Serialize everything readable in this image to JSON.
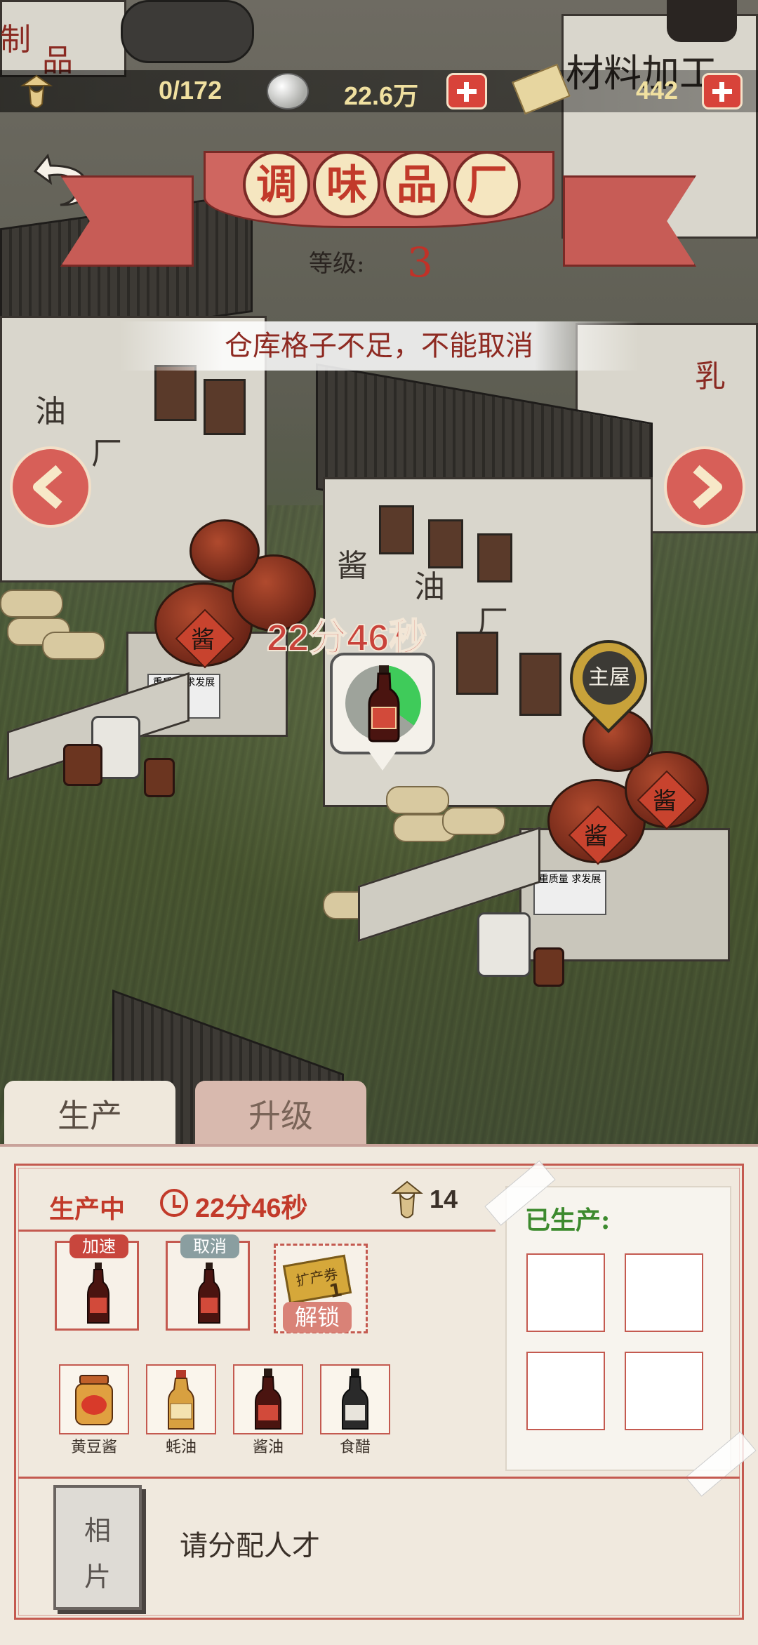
{
  "resources": {
    "workers": "0/172",
    "silver": "22.6万",
    "gold": "442"
  },
  "factory": {
    "title_chars": [
      "调",
      "味",
      "品",
      "厂"
    ],
    "level_label": "等级:",
    "level_value": "3",
    "warning": "仓库格子不足，不能取消"
  },
  "scene": {
    "timer": "22分46秒",
    "main_house_label": "主屋",
    "factory_sign": [
      "酱",
      "油",
      "厂"
    ],
    "left_sign": [
      "油",
      "厂"
    ],
    "jar_char": "酱",
    "background_sign": "材料加工",
    "left_top_sign": [
      "制",
      "品"
    ],
    "right_sign": "乳",
    "platform_note": "重质量 求发展"
  },
  "tabs": {
    "production": "生产",
    "upgrade": "升级"
  },
  "production": {
    "status_label": "生产中",
    "remaining_time": "22分46秒",
    "worker_count": "14",
    "slots": [
      {
        "tag": "加速",
        "product": "soy-sauce-bottle"
      },
      {
        "tag": "取消",
        "product": "soy-sauce-bottle"
      }
    ],
    "locked_slot": {
      "ticket_text": "扩产券",
      "ticket_count": "1",
      "button": "解锁"
    },
    "items": [
      {
        "name": "黄豆酱",
        "icon": "bean-paste-jar"
      },
      {
        "name": "蚝油",
        "icon": "oyster-sauce-bottle"
      },
      {
        "name": "酱油",
        "icon": "soy-sauce-bottle"
      },
      {
        "name": "食醋",
        "icon": "vinegar-bottle"
      }
    ]
  },
  "produced": {
    "title": "已生产:"
  },
  "talent": {
    "photo_chars": [
      "相",
      "片"
    ],
    "prompt": "请分配人才"
  },
  "colors": {
    "accent_red": "#c23a2a",
    "produced_green": "#3d8a2e",
    "progress_green": "#3fcb5a"
  },
  "progress_fraction": 0.35
}
